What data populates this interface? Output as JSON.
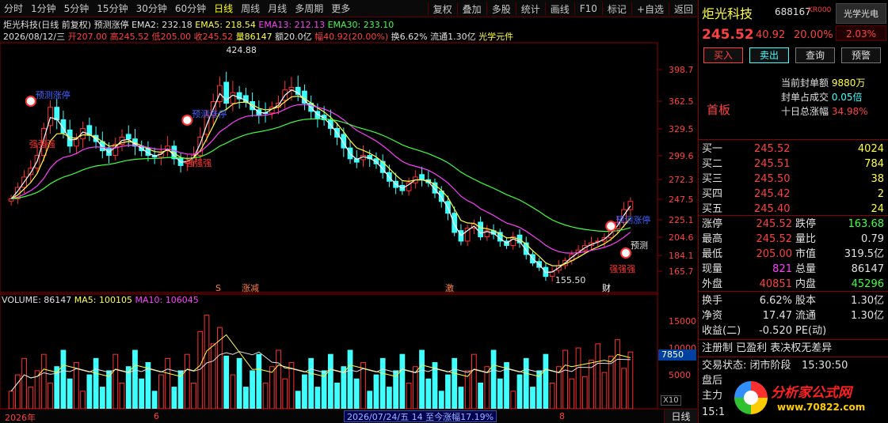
{
  "toolbar": {
    "left_items": [
      "分时",
      "1分钟",
      "5分钟",
      "15分钟",
      "30分钟",
      "60分钟",
      "日线",
      "周线",
      "月线",
      "多周期",
      "更多"
    ],
    "active_index": 6,
    "right_items": [
      "复权",
      "叠加",
      "多股",
      "统计",
      "画线",
      "F10",
      "标记",
      "+自选",
      "返回"
    ]
  },
  "info": {
    "stock_title": "炬光科技(日线 前复权)",
    "indicator": "预测涨停",
    "ema2": "EMA2: 232.18",
    "ema5": "EMA5: 218.54",
    "ema13": "EMA13: 212.13",
    "ema30": "EMA30: 233.10",
    "date": "2026/08/12/三",
    "open": "开207.00",
    "high": "高245.52",
    "low": "低205.00",
    "close": "收245.52",
    "volume": "量86147",
    "amount": "额20.0亿",
    "amplitude": "幅40.92(20.00%)",
    "turnover": "换6.62%",
    "float": "流通1.30亿",
    "concept": "光学元件"
  },
  "volume_header": {
    "volume": "VOLUME: 86147",
    "ma5": "MA5: 100105",
    "ma10": "MA10: 106045"
  },
  "chart_data": {
    "type": "candlestick",
    "price_ticks": [
      "398.7",
      "362.5",
      "329.5",
      "299.6",
      "272.3",
      "247.5",
      "225.1",
      "204.6",
      "184.1",
      "165.7"
    ],
    "volume_ticks": [
      "15000",
      "10000",
      "5000"
    ],
    "high_label": "424.88",
    "low_label": "155.50",
    "signal_labels": [
      "预测涨停",
      "预测涨停",
      "预测涨停"
    ],
    "strong_labels": [
      "强强强",
      "强强强",
      "强强强"
    ],
    "predict_label": "预测",
    "event_marks": [
      "S",
      "涨减",
      "激",
      "财"
    ],
    "volume_highlight": "7850",
    "x10_label": "X10"
  },
  "bottom": {
    "year_label": "2026年",
    "month6": "6",
    "month8": "8",
    "date_info": "2026/07/24/五 14 至今涨幅17.19%",
    "period": "日线"
  },
  "panel": {
    "name": "炬光科技",
    "name_suffix": "i",
    "code": "688167",
    "kr": "KR000",
    "concept_btn": "光学光电",
    "price": "245.52",
    "change": "40.92",
    "change_pct": "20.00%",
    "turnover_box": "2.03%",
    "buttons": [
      "买入",
      "卖出",
      "查询",
      "预警"
    ],
    "seal_amount_lbl": "当前封单额",
    "seal_amount_val": "9880万",
    "seal_ratio_lbl": "封单占成交",
    "seal_ratio_val": "0.05倍",
    "ten_day_lbl": "十日总涨幅",
    "ten_day_val": "34.98%",
    "first_board": "首板",
    "asks": [
      {
        "label": "买一",
        "price": "245.52",
        "vol": "4024"
      },
      {
        "label": "买二",
        "price": "245.51",
        "vol": "784"
      },
      {
        "label": "买三",
        "price": "245.50",
        "vol": "38"
      },
      {
        "label": "买四",
        "price": "245.42",
        "vol": "2"
      },
      {
        "label": "买五",
        "price": "245.40",
        "vol": "24"
      }
    ],
    "stats": [
      {
        "l1": "涨停",
        "v1": "245.52",
        "l2": "跌停",
        "v2": "163.68"
      },
      {
        "l1": "最高",
        "v1": "245.52",
        "l2": "量比",
        "v2": "0.79"
      },
      {
        "l1": "最低",
        "v1": "205.00",
        "l2": "市值",
        "v2": "319.5亿"
      },
      {
        "l1": "现量",
        "v1": "821",
        "l2": "总量",
        "v2": "86147"
      },
      {
        "l1": "外盘",
        "v1": "40851",
        "l2": "内盘",
        "v2": "45296"
      }
    ],
    "stats2": [
      {
        "l1": "换手",
        "v1": "6.62%",
        "l2": "股本",
        "v2": "1.30亿"
      },
      {
        "l1": "净资",
        "v1": "17.47",
        "l2": "流通",
        "v2": "1.30亿"
      },
      {
        "l1": "收益(二)",
        "v1": "-0.520",
        "l2": "PE(动)",
        "v2": ""
      }
    ],
    "reg_line": "注册制 已盈利 表决权无差异",
    "trade_status": "交易状态: 闭市阶段",
    "trade_time": "15:30:50",
    "after_line": "盘后",
    "main_line": "主力",
    "time_cut": "15:1"
  },
  "logo": {
    "text1": "分析家公式网",
    "text2": "www.70822.com"
  }
}
